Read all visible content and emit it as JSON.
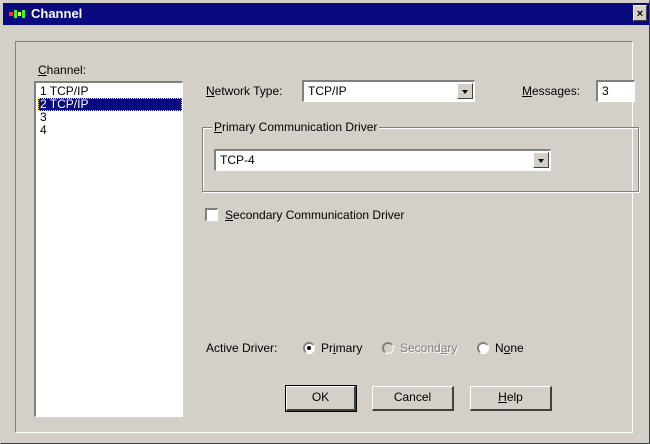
{
  "window": {
    "title": "Channel",
    "close_glyph": "×"
  },
  "channel_list": {
    "label_mnemonic": "C",
    "label_rest": "hannel:",
    "items": [
      "1  TCP/IP",
      "2  TCP/IP",
      "3",
      "4"
    ],
    "selected_index": 1
  },
  "network_type": {
    "label_mnemonic": "N",
    "label_rest": "etwork Type:",
    "value": "TCP/IP"
  },
  "messages": {
    "label_mnemonic": "M",
    "label_rest": "essages:",
    "value": "3"
  },
  "primary_driver": {
    "group_mnemonic": "P",
    "group_rest": "rimary Communication Driver",
    "value": "TCP-4"
  },
  "secondary_driver": {
    "label_mnemonic": "S",
    "label_rest": "econdary Communication Driver",
    "checked": false
  },
  "active_driver": {
    "label": "Active Driver:",
    "options": [
      {
        "pre": "Pr",
        "mnemonic": "i",
        "post": "mary",
        "selected": true,
        "enabled": true
      },
      {
        "pre": "Second",
        "mnemonic": "a",
        "post": "ry",
        "selected": false,
        "enabled": false
      },
      {
        "pre": "N",
        "mnemonic": "o",
        "post": "ne",
        "selected": false,
        "enabled": true
      }
    ]
  },
  "buttons": {
    "ok": "OK",
    "cancel": "Cancel",
    "help_mnemonic": "H",
    "help_rest": "elp"
  },
  "colors": {
    "titlebar": "#0a0a80",
    "face": "#d4d0c8",
    "selection": "#0a0a80"
  }
}
